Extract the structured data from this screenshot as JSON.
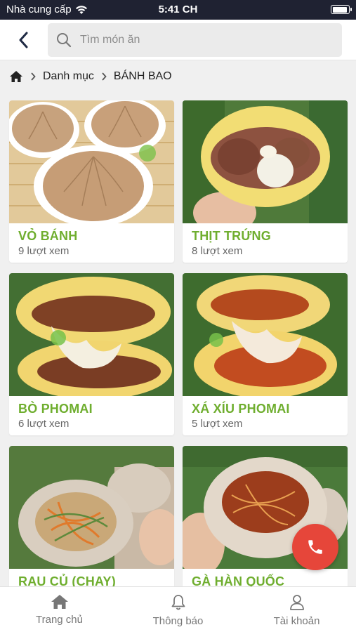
{
  "status": {
    "carrier": "Nhà cung cấp",
    "time": "5:41 CH",
    "battery_level": 0.95
  },
  "search": {
    "placeholder": "Tìm món ăn"
  },
  "breadcrumb": {
    "home_icon": "home-icon",
    "category": "Danh mục",
    "current": "BÁNH BAO"
  },
  "products": [
    {
      "title": "VỎ BÁNH",
      "views": "9 lượt xem"
    },
    {
      "title": "THỊT TRỨNG",
      "views": "8 lượt xem"
    },
    {
      "title": "BÒ PHOMAI",
      "views": "6 lượt xem"
    },
    {
      "title": "XÁ XÍU PHOMAI",
      "views": "5 lượt xem"
    },
    {
      "title": "RAU CỦ (CHAY)",
      "views": ""
    },
    {
      "title": "GÀ HÀN QUỐC",
      "views": ""
    }
  ],
  "tabs": [
    {
      "label": "Trang chủ",
      "icon": "home-icon"
    },
    {
      "label": "Thông báo",
      "icon": "bell-icon"
    },
    {
      "label": "Tài khoản",
      "icon": "user-icon"
    }
  ],
  "fab": {
    "icon": "phone-icon"
  },
  "colors": {
    "accent_green": "#6fae2f",
    "fab_red": "#e6463a",
    "status_bar": "#1f2232"
  }
}
